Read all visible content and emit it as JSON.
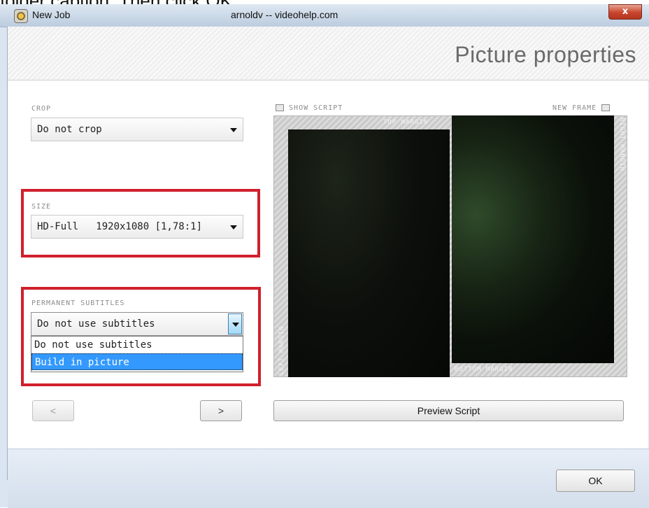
{
  "caption": {
    "text": "folder caption.  Then click OK."
  },
  "window": {
    "title": "New Job",
    "watermark": "arnoldv -- videohelp.com",
    "close_label": "x"
  },
  "page": {
    "title": "Picture properties"
  },
  "crop": {
    "label": "CROP",
    "value": "Do not crop"
  },
  "size": {
    "label": "SIZE",
    "value": "HD-Full   1920x1080 [1,78:1]"
  },
  "subtitles": {
    "label": "PERMANENT SUBTITLES",
    "value": "Do not use subtitles",
    "options": [
      "Do not use subtitles",
      "Build in picture"
    ],
    "highlighted": "Build in picture"
  },
  "preview": {
    "show_script": "SHOW SCRIPT",
    "new_frame": "NEW FRAME",
    "top_margin": "TOP MARGIN",
    "right_margin": "RIGHT MARGIN",
    "left_margin": "LEFT MARGIN",
    "bottom_margin": "BOTTOM MARGIN"
  },
  "nav": {
    "prev": "<",
    "next": ">"
  },
  "buttons": {
    "preview_script": "Preview Script",
    "ok": "OK"
  },
  "colors": {
    "highlight_box": "#d0202c",
    "selection": "#3399ff"
  }
}
